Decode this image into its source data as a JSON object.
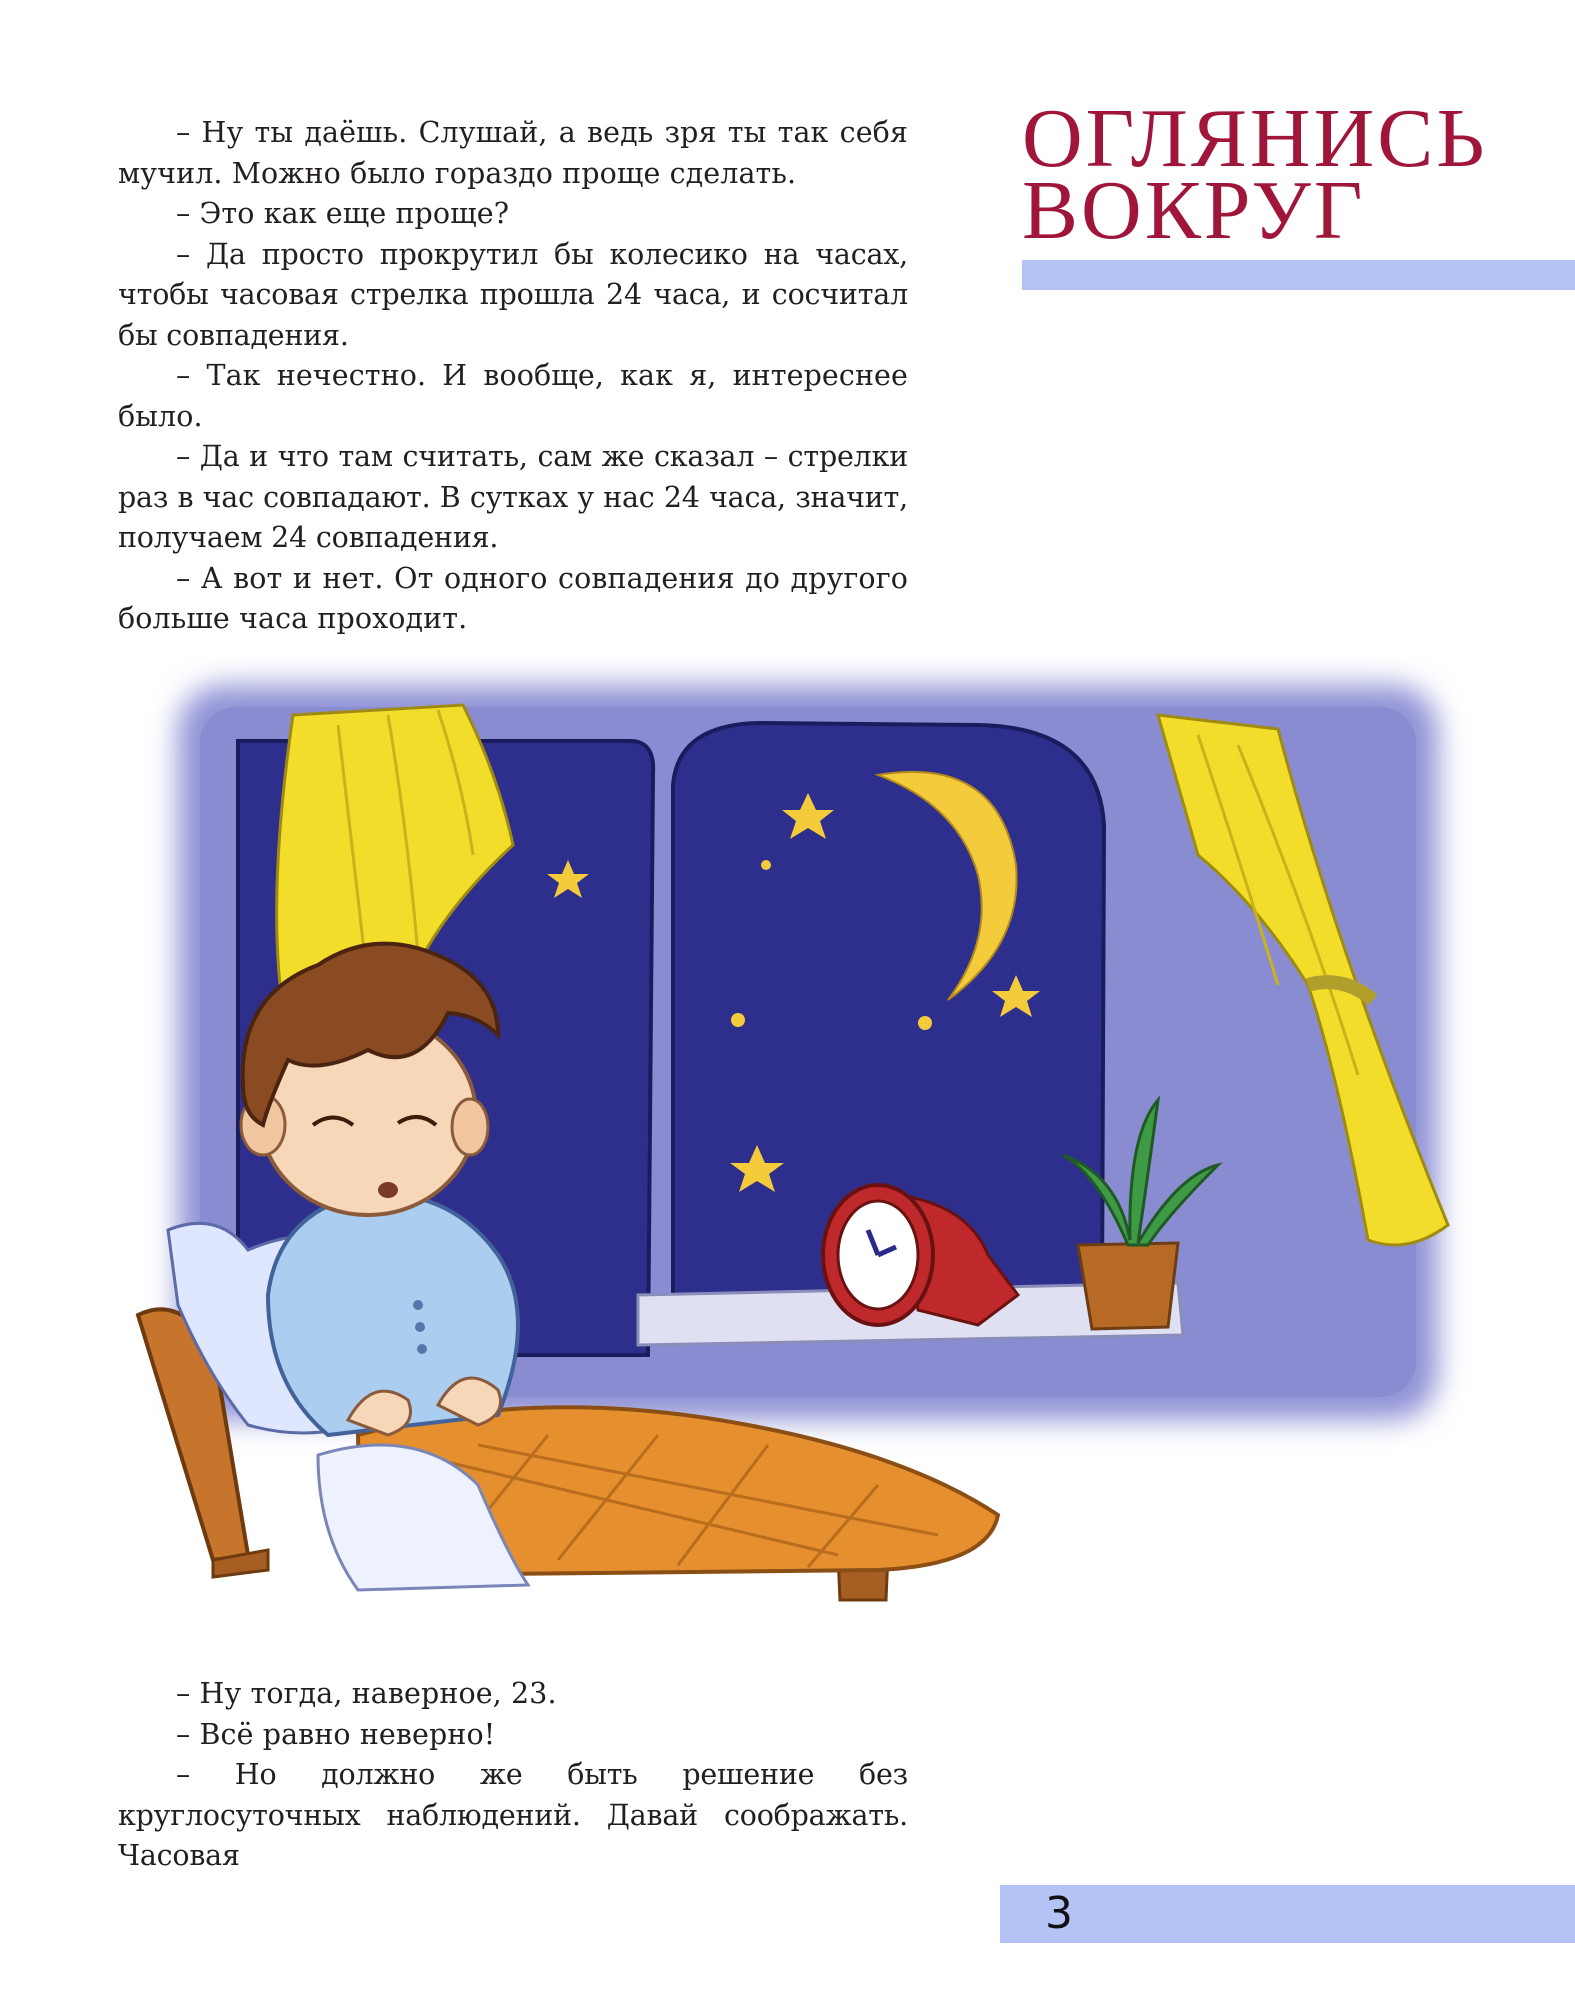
{
  "section": {
    "title_line1": "ОГЛЯНИСЬ",
    "title_line2": "ВОКРУГ"
  },
  "top_paragraphs": [
    "– Ну ты даёшь. Слушай, а ведь зря ты так себя мучил. Можно было гораздо проще сделать.",
    "– Это как еще проще?",
    "– Да просто прокрутил бы колесико на часах, чтобы часовая стрелка прошла 24 часа, и сосчитал бы совпадения.",
    "– Так нечестно. И вообще, как я, интереснее было.",
    "– Да и что там считать, сам же сказал – стрелки раз в час совпадают. В сутках у нас 24 часа, значит, получаем 24 совпадения.",
    "– А вот и нет. От одного совпадения до другого больше часа проходит."
  ],
  "bottom_paragraphs": [
    "– Ну тогда, наверное, 23.",
    "– Всё равно неверно!",
    "– Но должно же быть решение без круглосуточных наблюдений. Давай соображать. Часовая"
  ],
  "page_number": "3",
  "colors": {
    "title": "#a0163a",
    "accent_bar": "#b5c2f6",
    "wall": "#8f92d6",
    "night_sky": "#2e2f8c",
    "curtain": "#f2dd2a",
    "blanket": "#e58f2e"
  }
}
